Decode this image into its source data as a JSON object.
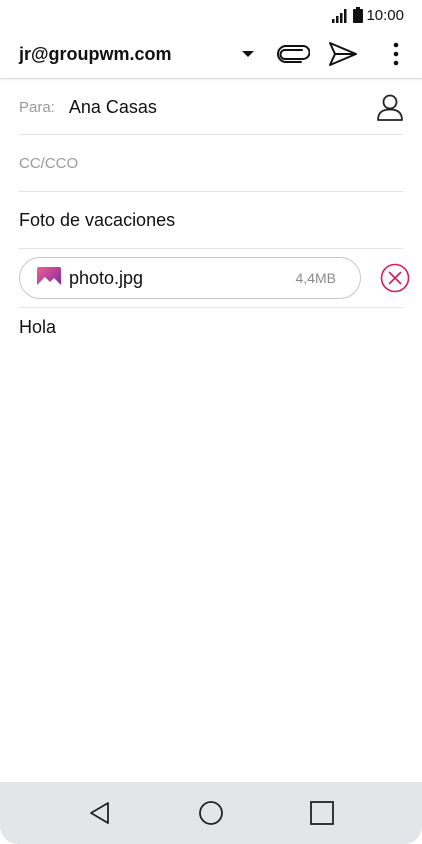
{
  "status_bar": {
    "time": "10:00",
    "icons": [
      "signal-icon",
      "battery-icon"
    ]
  },
  "app_bar": {
    "account": "jr@groupwm.com",
    "icons": [
      "dropdown-arrow-icon",
      "paperclip-icon",
      "send-icon",
      "more-vert-icon"
    ]
  },
  "compose": {
    "to_label": "Para:",
    "to_value": "Ana Casas",
    "cc_label": "CC/CCO",
    "subject": "Foto de vacaciones",
    "attachment": {
      "name": "photo.jpg",
      "size": "4,4MB"
    },
    "body": "Hola"
  },
  "nav": {
    "icons": [
      "back-icon",
      "home-icon",
      "recents-icon"
    ]
  },
  "colors": {
    "accent": "#d81b60",
    "nav_bg": "#e4e5e8",
    "divider": "#e3e3e3"
  }
}
